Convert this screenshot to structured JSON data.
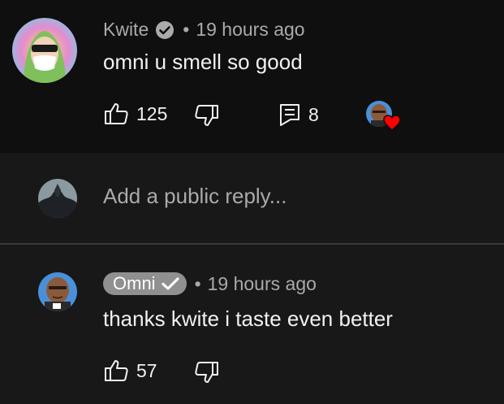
{
  "comment": {
    "author": "Kwite",
    "verified_icon": "verified-check-icon",
    "separator": "•",
    "timestamp": "19 hours ago",
    "text": "omni u smell so good",
    "likes": "125",
    "replies": "8",
    "icons": {
      "like": "thumbs-up-icon",
      "dislike": "thumbs-down-icon",
      "replies": "comment-icon",
      "heart": "creator-heart-icon"
    }
  },
  "reply_box": {
    "placeholder": "Add a public reply..."
  },
  "reply": {
    "author": "Omni",
    "verified_icon": "verified-check-icon",
    "separator": "•",
    "timestamp": "19 hours ago",
    "text": "thanks kwite i taste even better",
    "likes": "57"
  },
  "colors": {
    "background_top": "#0f0f0f",
    "background": "#181818",
    "text_primary": "#f1f1f1",
    "text_secondary": "#aaaaaa",
    "owner_badge": "#909090",
    "heart": "#ff0000",
    "divider": "#3a3a3a"
  }
}
